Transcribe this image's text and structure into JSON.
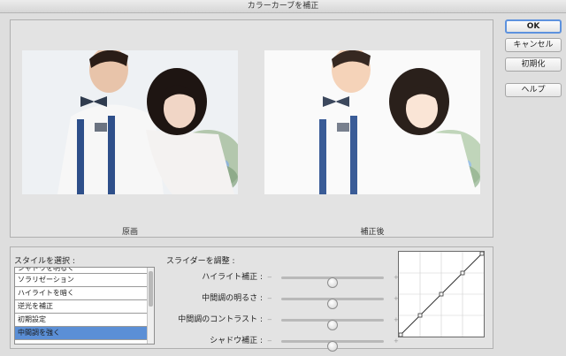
{
  "window": {
    "title": "カラーカーブを補正"
  },
  "preview": {
    "original_caption": "原画",
    "corrected_caption": "補正後"
  },
  "style_panel": {
    "label": "スタイルを選択 :",
    "items": [
      {
        "label": "シャドウを明るく",
        "selected": false,
        "partial": true
      },
      {
        "label": "ソラリゼーション",
        "selected": false
      },
      {
        "label": "ハイライトを暗く",
        "selected": false
      },
      {
        "label": "逆光を補正",
        "selected": false
      },
      {
        "label": "初期設定",
        "selected": false
      },
      {
        "label": "中間調を強く",
        "selected": true
      }
    ]
  },
  "slider_panel": {
    "label": "スライダーを調整 :",
    "minus_symbol": "−",
    "plus_symbol": "+",
    "sliders": [
      {
        "label": "ハイライト補正 :",
        "value": 0.5
      },
      {
        "label": "中間調の明るさ :",
        "value": 0.5
      },
      {
        "label": "中間調のコントラスト :",
        "value": 0.5
      },
      {
        "label": "シャドウ補正 :",
        "value": 0.5
      }
    ]
  },
  "curve": {
    "points": [
      [
        0,
        0
      ],
      [
        0.25,
        0.25
      ],
      [
        0.5,
        0.5
      ],
      [
        0.75,
        0.75
      ],
      [
        1,
        1
      ]
    ],
    "curve_color": "#333333",
    "grid_color": "#cfcfcf"
  },
  "buttons": {
    "ok": "OK",
    "cancel": "キャンセル",
    "reset": "初期化",
    "help": "ヘルプ"
  },
  "colors": {
    "accent": "#5d92de",
    "selection": "#5b8fd6",
    "suspender": "#2e4f8a",
    "shirt": "#ffffff",
    "hair": "#1e1512",
    "bouquet_green": "#a8bfa0",
    "bouquet_blue": "#8fb4d8",
    "bouquet_pink": "#e2b9c2"
  }
}
